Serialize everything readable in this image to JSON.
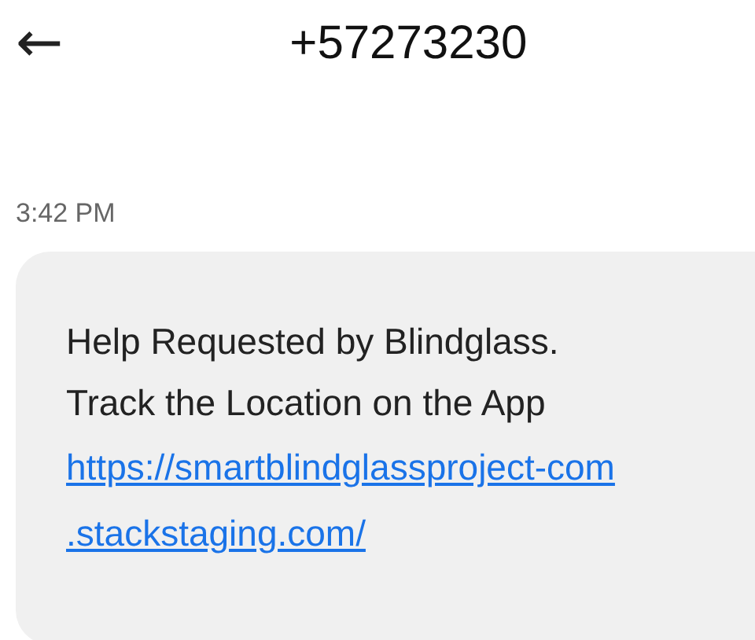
{
  "header": {
    "back": "←",
    "title": "+57273230"
  },
  "timestamp": "3:42 PM",
  "message": {
    "lines": [
      "Help Requested by Blindglass.",
      "Track the Location on the App"
    ],
    "link_lines": [
      "https://smartblindglassproject-com",
      ".stackstaging.com/"
    ]
  }
}
